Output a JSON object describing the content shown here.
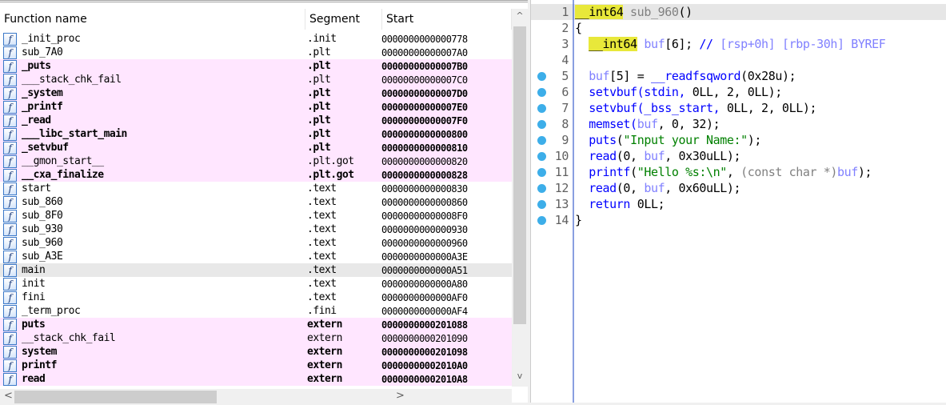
{
  "functions_table": {
    "headers": [
      "Function name",
      "Segment",
      "Start"
    ],
    "rows": [
      {
        "name": "_init_proc",
        "segment": ".init",
        "start": "0000000000000778",
        "style": "normal"
      },
      {
        "name": "sub_7A0",
        "segment": ".plt",
        "start": "00000000000007A0",
        "style": "normal"
      },
      {
        "name": "_puts",
        "segment": ".plt",
        "start": "00000000000007B0",
        "style": "pink-bold"
      },
      {
        "name": "___stack_chk_fail",
        "segment": ".plt",
        "start": "00000000000007C0",
        "style": "pink"
      },
      {
        "name": "_system",
        "segment": ".plt",
        "start": "00000000000007D0",
        "style": "pink-bold"
      },
      {
        "name": "_printf",
        "segment": ".plt",
        "start": "00000000000007E0",
        "style": "pink-bold"
      },
      {
        "name": "_read",
        "segment": ".plt",
        "start": "00000000000007F0",
        "style": "pink-bold"
      },
      {
        "name": "___libc_start_main",
        "segment": ".plt",
        "start": "0000000000000800",
        "style": "pink-bold"
      },
      {
        "name": "_setvbuf",
        "segment": ".plt",
        "start": "0000000000000810",
        "style": "pink-bold"
      },
      {
        "name": "__gmon_start__",
        "segment": ".plt.got",
        "start": "0000000000000820",
        "style": "pink"
      },
      {
        "name": "__cxa_finalize",
        "segment": ".plt.got",
        "start": "0000000000000828",
        "style": "pink-bold"
      },
      {
        "name": "start",
        "segment": ".text",
        "start": "0000000000000830",
        "style": "normal"
      },
      {
        "name": "sub_860",
        "segment": ".text",
        "start": "0000000000000860",
        "style": "normal"
      },
      {
        "name": "sub_8F0",
        "segment": ".text",
        "start": "00000000000008F0",
        "style": "normal"
      },
      {
        "name": "sub_930",
        "segment": ".text",
        "start": "0000000000000930",
        "style": "normal"
      },
      {
        "name": "sub_960",
        "segment": ".text",
        "start": "0000000000000960",
        "style": "normal"
      },
      {
        "name": "sub_A3E",
        "segment": ".text",
        "start": "0000000000000A3E",
        "style": "normal"
      },
      {
        "name": "main",
        "segment": ".text",
        "start": "0000000000000A51",
        "style": "selected"
      },
      {
        "name": "init",
        "segment": ".text",
        "start": "0000000000000A80",
        "style": "normal"
      },
      {
        "name": "fini",
        "segment": ".text",
        "start": "0000000000000AF0",
        "style": "normal"
      },
      {
        "name": "_term_proc",
        "segment": ".fini",
        "start": "0000000000000AF4",
        "style": "normal"
      },
      {
        "name": "puts",
        "segment": "extern",
        "start": "0000000000201088",
        "style": "pink-bold"
      },
      {
        "name": "__stack_chk_fail",
        "segment": "extern",
        "start": "0000000000201090",
        "style": "pink"
      },
      {
        "name": "system",
        "segment": "extern",
        "start": "0000000000201098",
        "style": "pink-bold"
      },
      {
        "name": "printf",
        "segment": "extern",
        "start": "00000000002010A0",
        "style": "pink-bold"
      },
      {
        "name": "read",
        "segment": "extern",
        "start": "00000000002010A8",
        "style": "pink-bold"
      }
    ],
    "icon_glyph": "f"
  },
  "pseudocode": {
    "lines": [
      {
        "n": "1",
        "dot": false,
        "tokens": [
          [
            "hl",
            "__int64"
          ],
          [
            "gr",
            " sub_960"
          ],
          [
            "blk",
            "()"
          ]
        ]
      },
      {
        "n": "2",
        "dot": false,
        "tokens": [
          [
            "blk",
            "{"
          ]
        ]
      },
      {
        "n": "3",
        "dot": false,
        "tokens": [
          [
            "blk",
            "  "
          ],
          [
            "hl",
            "__int64"
          ],
          [
            "var",
            " buf"
          ],
          [
            "blk",
            "[6]; "
          ],
          [
            "kw",
            "//"
          ],
          [
            "cm",
            " [rsp+0h] [rbp-30h] BYREF"
          ]
        ]
      },
      {
        "n": "4",
        "dot": false,
        "tokens": []
      },
      {
        "n": "5",
        "dot": true,
        "tokens": [
          [
            "blk",
            "  "
          ],
          [
            "var",
            "buf"
          ],
          [
            "blk",
            "[5] = "
          ],
          [
            "kw",
            "__readfsqword"
          ],
          [
            "blk",
            "(0x28u);"
          ]
        ]
      },
      {
        "n": "6",
        "dot": true,
        "tokens": [
          [
            "blk",
            "  "
          ],
          [
            "kw",
            "setvbuf(stdin, "
          ],
          [
            "blk",
            "0LL, 2, 0LL);"
          ]
        ]
      },
      {
        "n": "7",
        "dot": true,
        "tokens": [
          [
            "blk",
            "  "
          ],
          [
            "kw",
            "setvbuf(_bss_start, "
          ],
          [
            "blk",
            "0LL, 2, 0LL);"
          ]
        ]
      },
      {
        "n": "8",
        "dot": true,
        "tokens": [
          [
            "blk",
            "  "
          ],
          [
            "kw",
            "memset("
          ],
          [
            "var",
            "buf"
          ],
          [
            "blk",
            ", 0, 32);"
          ]
        ]
      },
      {
        "n": "9",
        "dot": true,
        "tokens": [
          [
            "blk",
            "  "
          ],
          [
            "kw",
            "puts"
          ],
          [
            "blk",
            "("
          ],
          [
            "str",
            "\"Input your Name:\""
          ],
          [
            "blk",
            ");"
          ]
        ]
      },
      {
        "n": "10",
        "dot": true,
        "tokens": [
          [
            "blk",
            "  "
          ],
          [
            "kw",
            "read"
          ],
          [
            "blk",
            "(0, "
          ],
          [
            "var",
            "buf"
          ],
          [
            "blk",
            ", 0x30uLL);"
          ]
        ]
      },
      {
        "n": "11",
        "dot": true,
        "tokens": [
          [
            "blk",
            "  "
          ],
          [
            "kw",
            "printf"
          ],
          [
            "blk",
            "("
          ],
          [
            "str",
            "\"Hello %s:\\n\""
          ],
          [
            "blk",
            ", "
          ],
          [
            "gr",
            "(const char *)"
          ],
          [
            "var",
            "buf"
          ],
          [
            "blk",
            ");"
          ]
        ]
      },
      {
        "n": "12",
        "dot": true,
        "tokens": [
          [
            "blk",
            "  "
          ],
          [
            "kw",
            "read"
          ],
          [
            "blk",
            "(0, "
          ],
          [
            "var",
            "buf"
          ],
          [
            "blk",
            ", 0x60uLL);"
          ]
        ]
      },
      {
        "n": "13",
        "dot": true,
        "tokens": [
          [
            "blk",
            "  "
          ],
          [
            "kw",
            "return "
          ],
          [
            "blk",
            "0LL;"
          ]
        ]
      },
      {
        "n": "14",
        "dot": true,
        "tokens": [
          [
            "blk",
            "}"
          ]
        ]
      }
    ]
  },
  "scroll": {
    "up": "^",
    "down": "v",
    "left": "<",
    "right": ">"
  }
}
